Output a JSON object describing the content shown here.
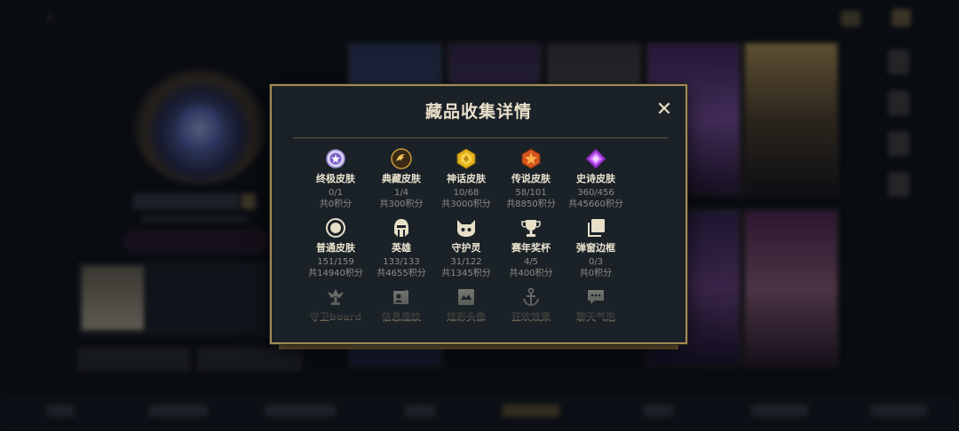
{
  "modal": {
    "title": "藏品收集详情",
    "close_symbol": "✕",
    "items_row1": [
      {
        "label": "终极皮肤",
        "count": "0/1",
        "points": "共0积分",
        "icon": "ultimate-skin-icon"
      },
      {
        "label": "典藏皮肤",
        "count": "1/4",
        "points": "共300积分",
        "icon": "legacy-skin-icon"
      },
      {
        "label": "神话皮肤",
        "count": "10/68",
        "points": "共3000积分",
        "icon": "mythic-skin-icon"
      },
      {
        "label": "传说皮肤",
        "count": "58/101",
        "points": "共8850积分",
        "icon": "legendary-skin-icon"
      },
      {
        "label": "史诗皮肤",
        "count": "360/456",
        "points": "共45660积分",
        "icon": "epic-skin-icon"
      }
    ],
    "items_row2": [
      {
        "label": "普通皮肤",
        "count": "151/159",
        "points": "共14940积分",
        "icon": "normal-skin-icon"
      },
      {
        "label": "英雄",
        "count": "133/133",
        "points": "共4655积分",
        "icon": "champion-icon"
      },
      {
        "label": "守护灵",
        "count": "31/122",
        "points": "共1345积分",
        "icon": "guardian-icon"
      },
      {
        "label": "赛年奖杯",
        "count": "4/5",
        "points": "共400积分",
        "icon": "trophy-icon"
      },
      {
        "label": "弹窗边框",
        "count": "0/3",
        "points": "共0积分",
        "icon": "frame-icon"
      }
    ],
    "items_row3": [
      {
        "label": "守卫board",
        "icon": "ward-icon"
      },
      {
        "label": "信息底纹",
        "icon": "profile-banner-icon"
      },
      {
        "label": "炫彩头像",
        "icon": "icon-border-icon"
      },
      {
        "label": "狂欢效果",
        "icon": "anchor-effect-icon"
      },
      {
        "label": "聊天气泡",
        "icon": "chat-bubble-icon"
      }
    ]
  },
  "colors": {
    "gold": "#a68a55",
    "panel": "#1a2228",
    "title": "#e9dfc9"
  }
}
